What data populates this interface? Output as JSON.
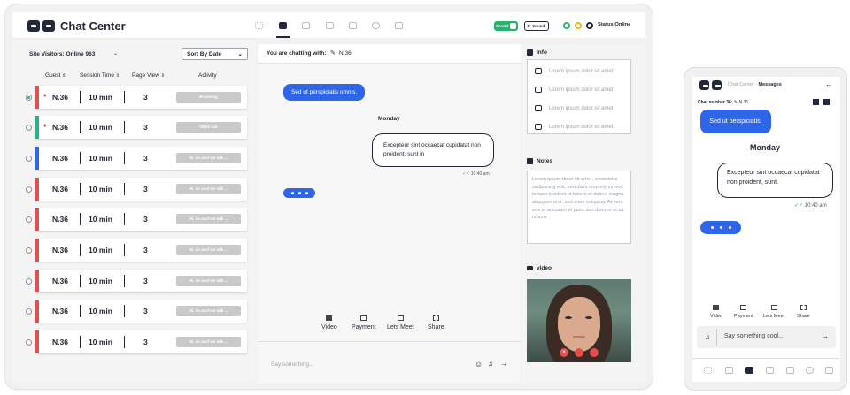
{
  "app": {
    "title": "Chat Center"
  },
  "header": {
    "toggle1_label": "Sound",
    "toggle2_label": "Sound",
    "status_text": "Status Online"
  },
  "left": {
    "site_visitors_label": "Site Visitors:",
    "online_count": "Online 963",
    "sort_label": "Sort By Date",
    "columns": [
      "Guest",
      "Session Time",
      "Page View",
      "Activity"
    ],
    "rows": [
      {
        "guest": "N.36",
        "time": "10 min",
        "views": "3",
        "activity": "Browsing",
        "color": "#e64d4d",
        "selected": true,
        "flag": true
      },
      {
        "guest": "N.36",
        "time": "10 min",
        "views": "3",
        "activity": "Other tab",
        "color": "#26b57e",
        "selected": false,
        "flag": true
      },
      {
        "guest": "N.36",
        "time": "10 min",
        "views": "3",
        "activity": "Hi, its asaf we talk ...",
        "color": "#2f66e8",
        "selected": false,
        "flag": false
      },
      {
        "guest": "N.36",
        "time": "10 min",
        "views": "3",
        "activity": "Hi, its asaf we talk ...",
        "color": "#e64d4d",
        "selected": false,
        "flag": false
      },
      {
        "guest": "N.36",
        "time": "10 min",
        "views": "3",
        "activity": "Hi, its asaf we talk ...",
        "color": "#e64d4d",
        "selected": false,
        "flag": false
      },
      {
        "guest": "N.36",
        "time": "10 min",
        "views": "3",
        "activity": "Hi, its asaf we talk ...",
        "color": "#e64d4d",
        "selected": false,
        "flag": false
      },
      {
        "guest": "N.36",
        "time": "10 min",
        "views": "3",
        "activity": "Hi, its asaf we talk ...",
        "color": "#e64d4d",
        "selected": false,
        "flag": false
      },
      {
        "guest": "N.36",
        "time": "10 min",
        "views": "3",
        "activity": "Hi, its asaf we talk ...",
        "color": "#e64d4d",
        "selected": false,
        "flag": false
      },
      {
        "guest": "N.36",
        "time": "10 min",
        "views": "3",
        "activity": "Hi, its asaf we talk ...",
        "color": "#e64d4d",
        "selected": false,
        "flag": false
      }
    ]
  },
  "chat": {
    "chatting_with_label": "You are chatting with:",
    "chatting_with_name": "N.36",
    "msg_in": "Sed ut perspiciatis omnis.",
    "day": "Monday",
    "msg_out": "Excepteur sint occaecat cupidatat non proident, sunt in",
    "msg_time": "10:40 am",
    "actions": [
      "Video",
      "Payment",
      "Lets Meet",
      "Share"
    ],
    "input_placeholder": "Say something..."
  },
  "right": {
    "info_title": "Info",
    "info_items": [
      "Lorem ipsum dolor sit amet,",
      "Lorem ipsum dolor sit amet,",
      "Lorem ipsum dolor sit amet,",
      "Lorem ipsum dolor sit amet,"
    ],
    "notes_title": "Notes",
    "notes_text": "Lorem ipsum dolor sit amet, consetetur sadipscing elitr, sed diam nonumy eirmod tempor invidunt ut labore et dolore magna aliquyam erat, sed diam voluptua. At vero eos et accusam et justo duo dolores et ea rebum.",
    "video_title": "video"
  },
  "phone": {
    "title_prefix": "Chat Center -",
    "title_bold": "Messages",
    "chat_number": "Chat number 36:",
    "chat_name": "N.36",
    "msg_in": "Sed ut perspiciatis.",
    "day": "Monday",
    "msg_out": "Excepteur sint occaecat cupidatat non proident, sunt.",
    "msg_time": "10:40 am",
    "actions": [
      "Video",
      "Payment",
      "Lets Meet",
      "Share"
    ],
    "input_placeholder": "Say something cool..."
  },
  "colors": {
    "accent": "#2f66e8",
    "dark": "#23283a",
    "green": "#27b36b",
    "red": "#e64d4d"
  }
}
